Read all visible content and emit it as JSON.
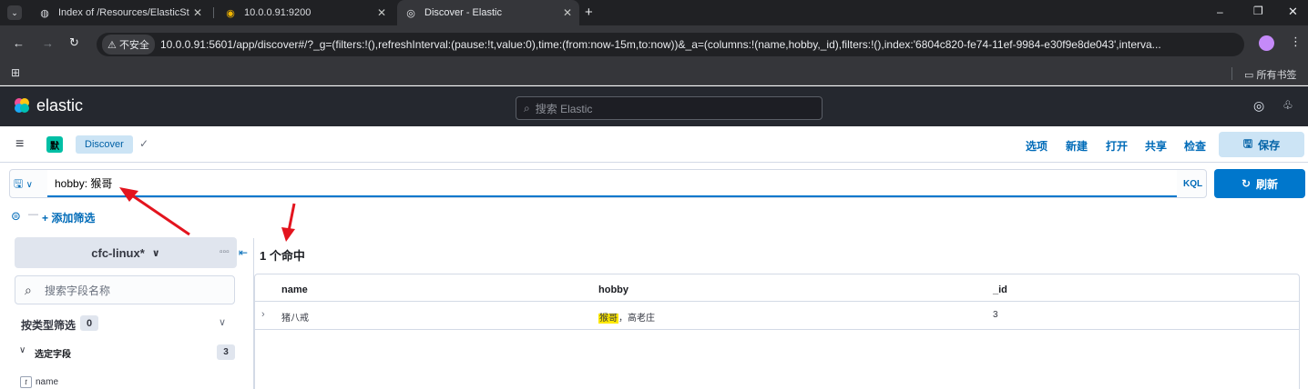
{
  "browser": {
    "tabs": [
      {
        "title": "Index of /Resources/ElasticSt",
        "active": false
      },
      {
        "title": "10.0.0.91:9200",
        "active": false
      },
      {
        "title": "Discover - Elastic",
        "active": true
      }
    ],
    "new_tab": "+",
    "minimize": "–",
    "restore": "❐",
    "close": "✕",
    "security_label": "不安全",
    "url": "10.0.0.91:5601/app/discover#/?_g=(filters:!(),refreshInterval:(pause:!t,value:0),time:(from:now-15m,to:now))&_a=(columns:!(name,hobby,_id),filters:!(),index:'6804c820-fe74-11ef-9984-e30f9e8de043',interva...",
    "bookmarks_label": "所有书签"
  },
  "kibana": {
    "logo_text": "elastic",
    "search_placeholder": "搜索 Elastic",
    "space_badge": "默",
    "breadcrumb": "Discover",
    "top_menu": [
      "选项",
      "新建",
      "打开",
      "共享",
      "检查"
    ],
    "save_label": "保存",
    "query_value": "hobby: 猴哥",
    "query_language": "KQL",
    "refresh_label": "刷新",
    "add_filter": "+ 添加筛选",
    "index_pattern": "cfc-linux*",
    "hits_label": "1 个命中",
    "field_search_placeholder": "搜索字段名称",
    "filter_by_type": "按类型筛选",
    "filter_count": "0",
    "selected_fields_label": "选定字段",
    "selected_fields_count": "3",
    "field_item": "name",
    "columns": [
      "name",
      "hobby",
      "_id"
    ],
    "rows": [
      {
        "name": "猪八戒",
        "hobby_highlight": "猴哥",
        "hobby_rest": "，高老庄",
        "id": "3"
      }
    ]
  },
  "colors": {
    "accent": "#0077cc",
    "highlight": "#ffe900",
    "annotation": "#e3141e"
  }
}
